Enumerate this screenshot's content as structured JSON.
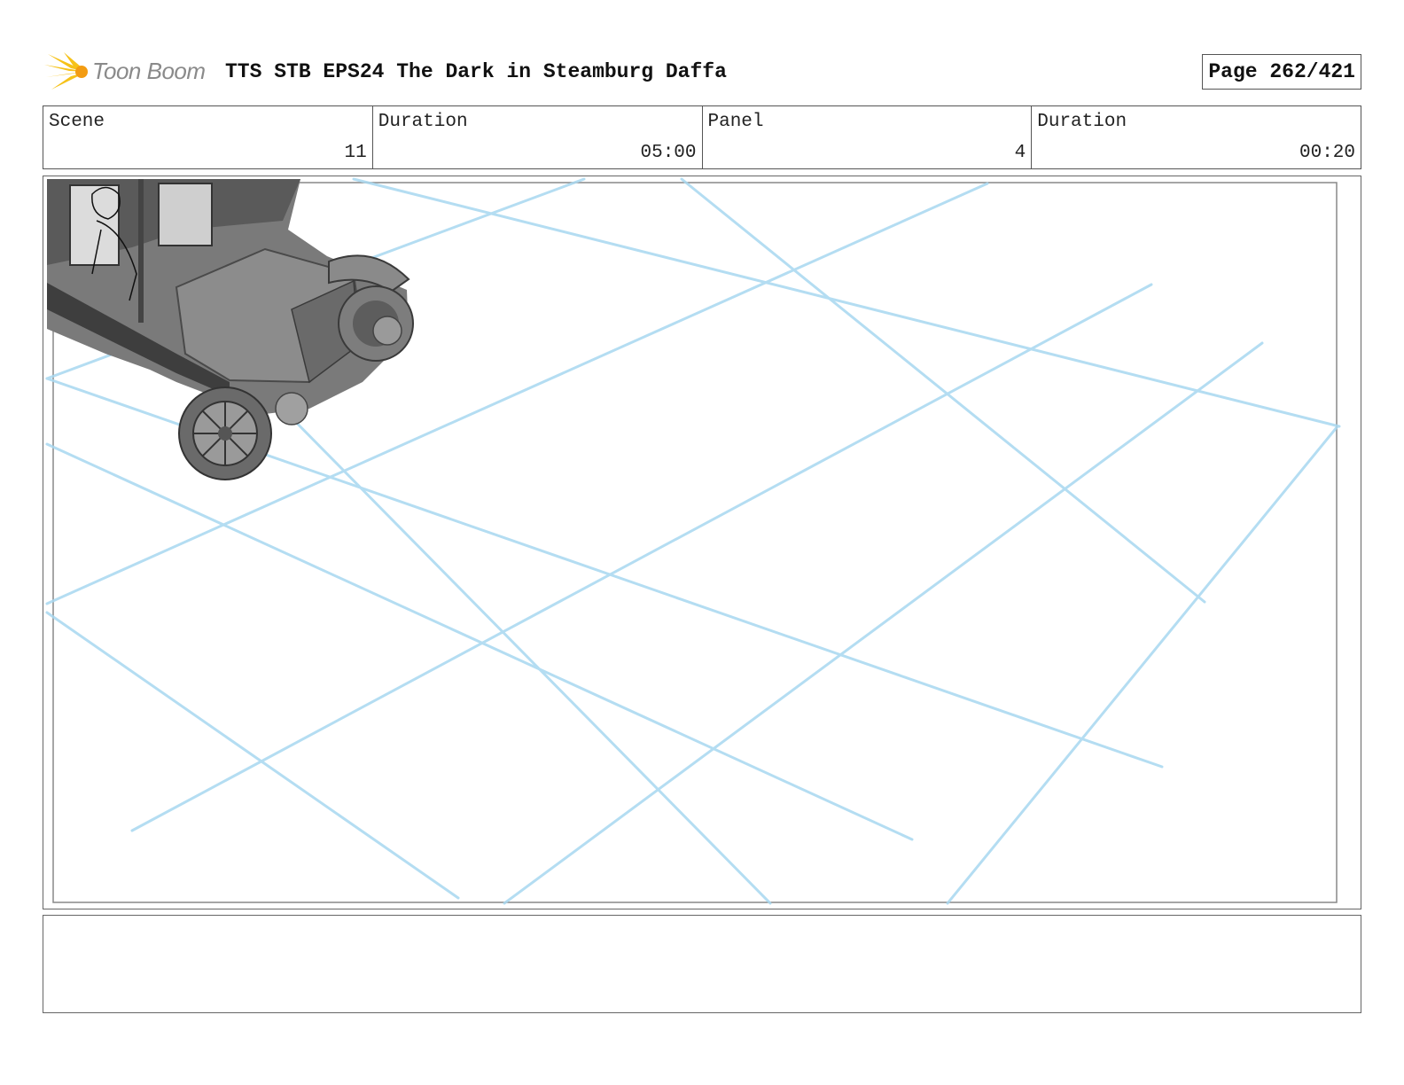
{
  "header": {
    "logo_text": "Toon Boom",
    "title": "TTS STB EPS24 The Dark in Steamburg Daffa",
    "page_label": "Page 262/421"
  },
  "info": [
    {
      "label": "Scene",
      "value": "11"
    },
    {
      "label": "Duration",
      "value": "05:00"
    },
    {
      "label": "Panel",
      "value": "4"
    },
    {
      "label": "Duration",
      "value": "00:20"
    }
  ],
  "panel": {
    "grid_color": "#a8d8f0",
    "car_color": "#6e6e6e"
  },
  "notes": ""
}
